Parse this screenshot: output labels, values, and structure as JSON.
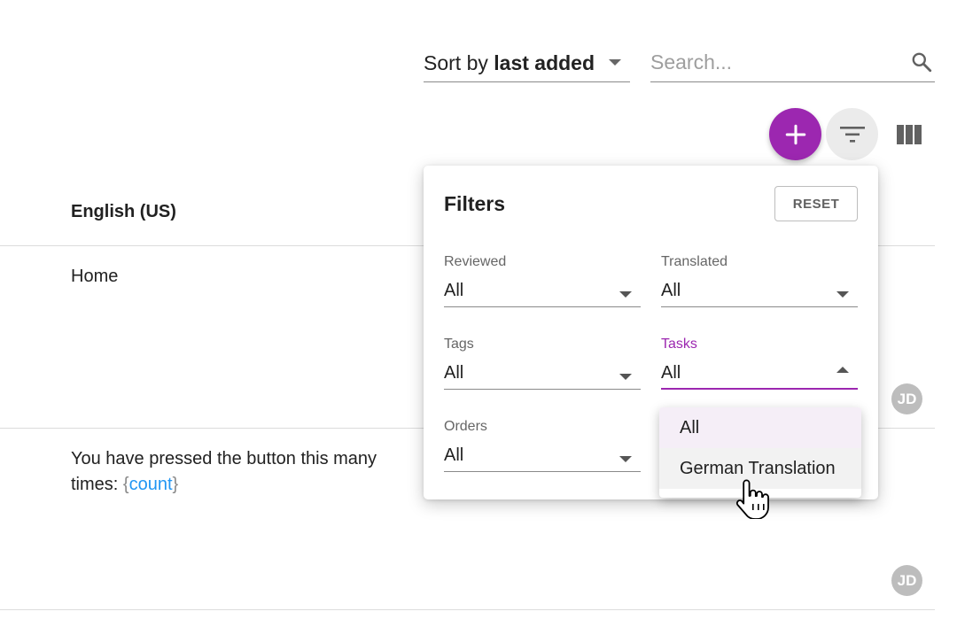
{
  "toolbar": {
    "sort_prefix": "Sort by ",
    "sort_value": "last added",
    "search_placeholder": "Search..."
  },
  "table": {
    "column_header": "English (US)",
    "rows": [
      {
        "text": "Home",
        "avatar": "JD"
      },
      {
        "text_before": "You have pressed the button this many",
        "text_line2": "times: ",
        "brace_open": "{",
        "param": "count",
        "brace_close": "}",
        "avatar": "JD"
      }
    ]
  },
  "filters": {
    "title": "Filters",
    "reset_label": "RESET",
    "reviewed": {
      "label": "Reviewed",
      "value": "All"
    },
    "translated": {
      "label": "Translated",
      "value": "All"
    },
    "tags": {
      "label": "Tags",
      "value": "All"
    },
    "tasks": {
      "label": "Tasks",
      "value": "All",
      "open": true
    },
    "orders": {
      "label": "Orders",
      "value": "All"
    }
  },
  "tasks_dropdown": {
    "options": [
      "All",
      "German Translation"
    ],
    "selected": "All",
    "hovered": "German Translation"
  },
  "colors": {
    "accent": "#9c27b0",
    "link": "#2196f3",
    "avatar_bg": "#bdbdbd"
  },
  "icons": {
    "search": "search-icon",
    "add": "plus-icon",
    "filter": "filter-icon",
    "columns": "columns-icon",
    "cursor": "hand-cursor-icon"
  }
}
